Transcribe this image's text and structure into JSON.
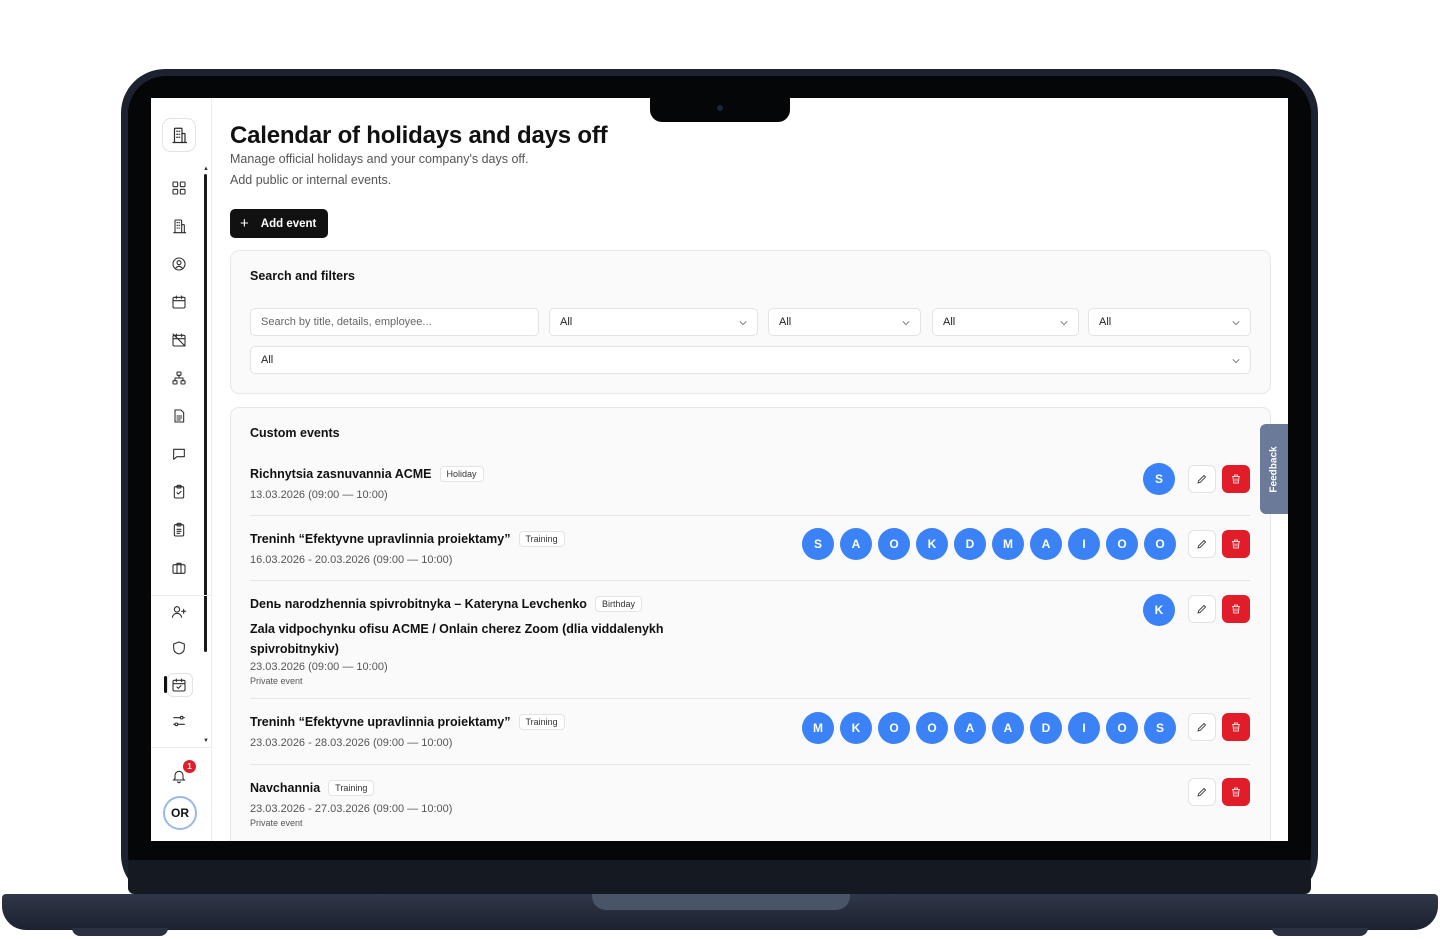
{
  "page": {
    "title": "Calendar of holidays and days off",
    "subtitle_1": "Manage official holidays and your company's days off.",
    "subtitle_2": "Add public or internal events.",
    "add_event_label": "Add event"
  },
  "filters": {
    "title": "Search and filters",
    "search_placeholder": "Search by title, details, employee...",
    "selects": [
      "All",
      "All",
      "All",
      "All",
      "All"
    ]
  },
  "events": {
    "title": "Custom events",
    "items": [
      {
        "title": "Richnytsia zasnuvannia ACME",
        "badge": "Holiday",
        "date": "13.03.2026 (09:00 — 10:00)",
        "participants": [
          "S"
        ]
      },
      {
        "title": "Treninh “Efektyvne upravlinnia proiektamy”",
        "badge": "Training",
        "date": "16.03.2026 - 20.03.2026 (09:00 — 10:00)",
        "participants": [
          "S",
          "A",
          "O",
          "K",
          "D",
          "M",
          "A",
          "I",
          "O",
          "O"
        ]
      },
      {
        "title": "Denь narodzhennia spivrobitnyka – Kateryna Levchenko",
        "badge": "Birthday",
        "location": "Zala vidpochynku ofisu ACME / Onlain cherez Zoom (dlia viddalenykh spivrobitnykiv)",
        "date": "23.03.2026 (09:00 — 10:00)",
        "note": "Private event",
        "participants": [
          "K"
        ]
      },
      {
        "title": "Treninh “Efektyvne upravlinnia proiektamy”",
        "badge": "Training",
        "date": "23.03.2026 - 28.03.2026 (09:00 — 10:00)",
        "participants": [
          "M",
          "K",
          "O",
          "O",
          "A",
          "A",
          "D",
          "I",
          "O",
          "S"
        ]
      },
      {
        "title": "Navchannia",
        "badge": "Training",
        "date": "23.03.2026 - 27.03.2026 (09:00 — 10:00)",
        "note": "Private event",
        "participants": []
      }
    ]
  },
  "sidebar": {
    "notification_count": "1",
    "user_initials": "OR",
    "icons": [
      "dashboard-icon",
      "company-icon",
      "user-circle-icon",
      "calendar-icon",
      "calendar-off-icon",
      "org-chart-icon",
      "document-icon",
      "chat-icon",
      "clipboard-check-icon",
      "clipboard-list-icon",
      "briefcase-icon",
      "user-plus-icon",
      "shield-icon",
      "calendar-check-icon",
      "settings-sliders-icon"
    ]
  },
  "feedback_label": "Feedback",
  "colors": {
    "accent": "#3b82f6",
    "danger": "#e11d2a",
    "primary_button": "#111111"
  }
}
